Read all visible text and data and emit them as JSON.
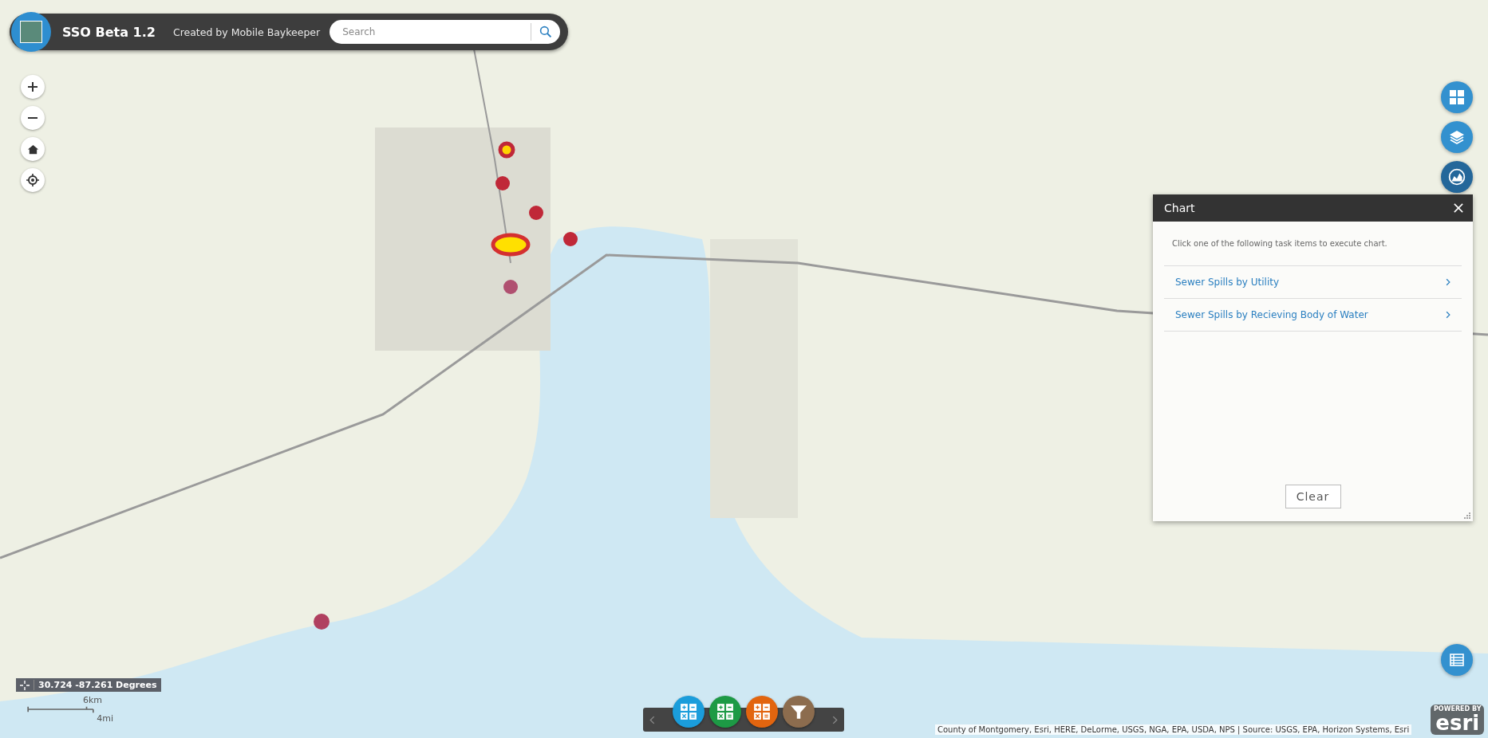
{
  "header": {
    "title": "SSO Beta 1.2",
    "subtitle": "Created by Mobile Baykeeper",
    "search": {
      "placeholder": "Search"
    }
  },
  "widget_buttons": [
    {
      "kind": "grid",
      "selected": false
    },
    {
      "kind": "layers",
      "selected": false
    },
    {
      "kind": "chart",
      "selected": true
    }
  ],
  "chart_panel": {
    "title": "Chart",
    "instruction": "Click one of the following task items to execute chart.",
    "items": [
      {
        "label": "Sewer Spills by Utility"
      },
      {
        "label": "Sewer Spills by Recieving Body of Water"
      }
    ],
    "clear_button": "Clear"
  },
  "coordinates": "30.724 -87.261 Degrees",
  "scale_bar": {
    "metric": "6km",
    "imperial": "4mi"
  },
  "toolbar": {
    "tools": [
      {
        "kind": "calculator",
        "color": "#1b9ddb"
      },
      {
        "kind": "calculator",
        "color": "#1d9a45"
      },
      {
        "kind": "calculator",
        "color": "#e2650f"
      },
      {
        "kind": "filter",
        "color": "#8c6c4e"
      }
    ]
  },
  "attribution": "County of Montgomery, Esri, HERE, DeLorme, USGS, NGA, EPA, USDA, NPS | Source: USGS, EPA, Horizon Systems, Esri",
  "esri_logo": {
    "tagline": "POWERED BY",
    "brand": "esri"
  }
}
